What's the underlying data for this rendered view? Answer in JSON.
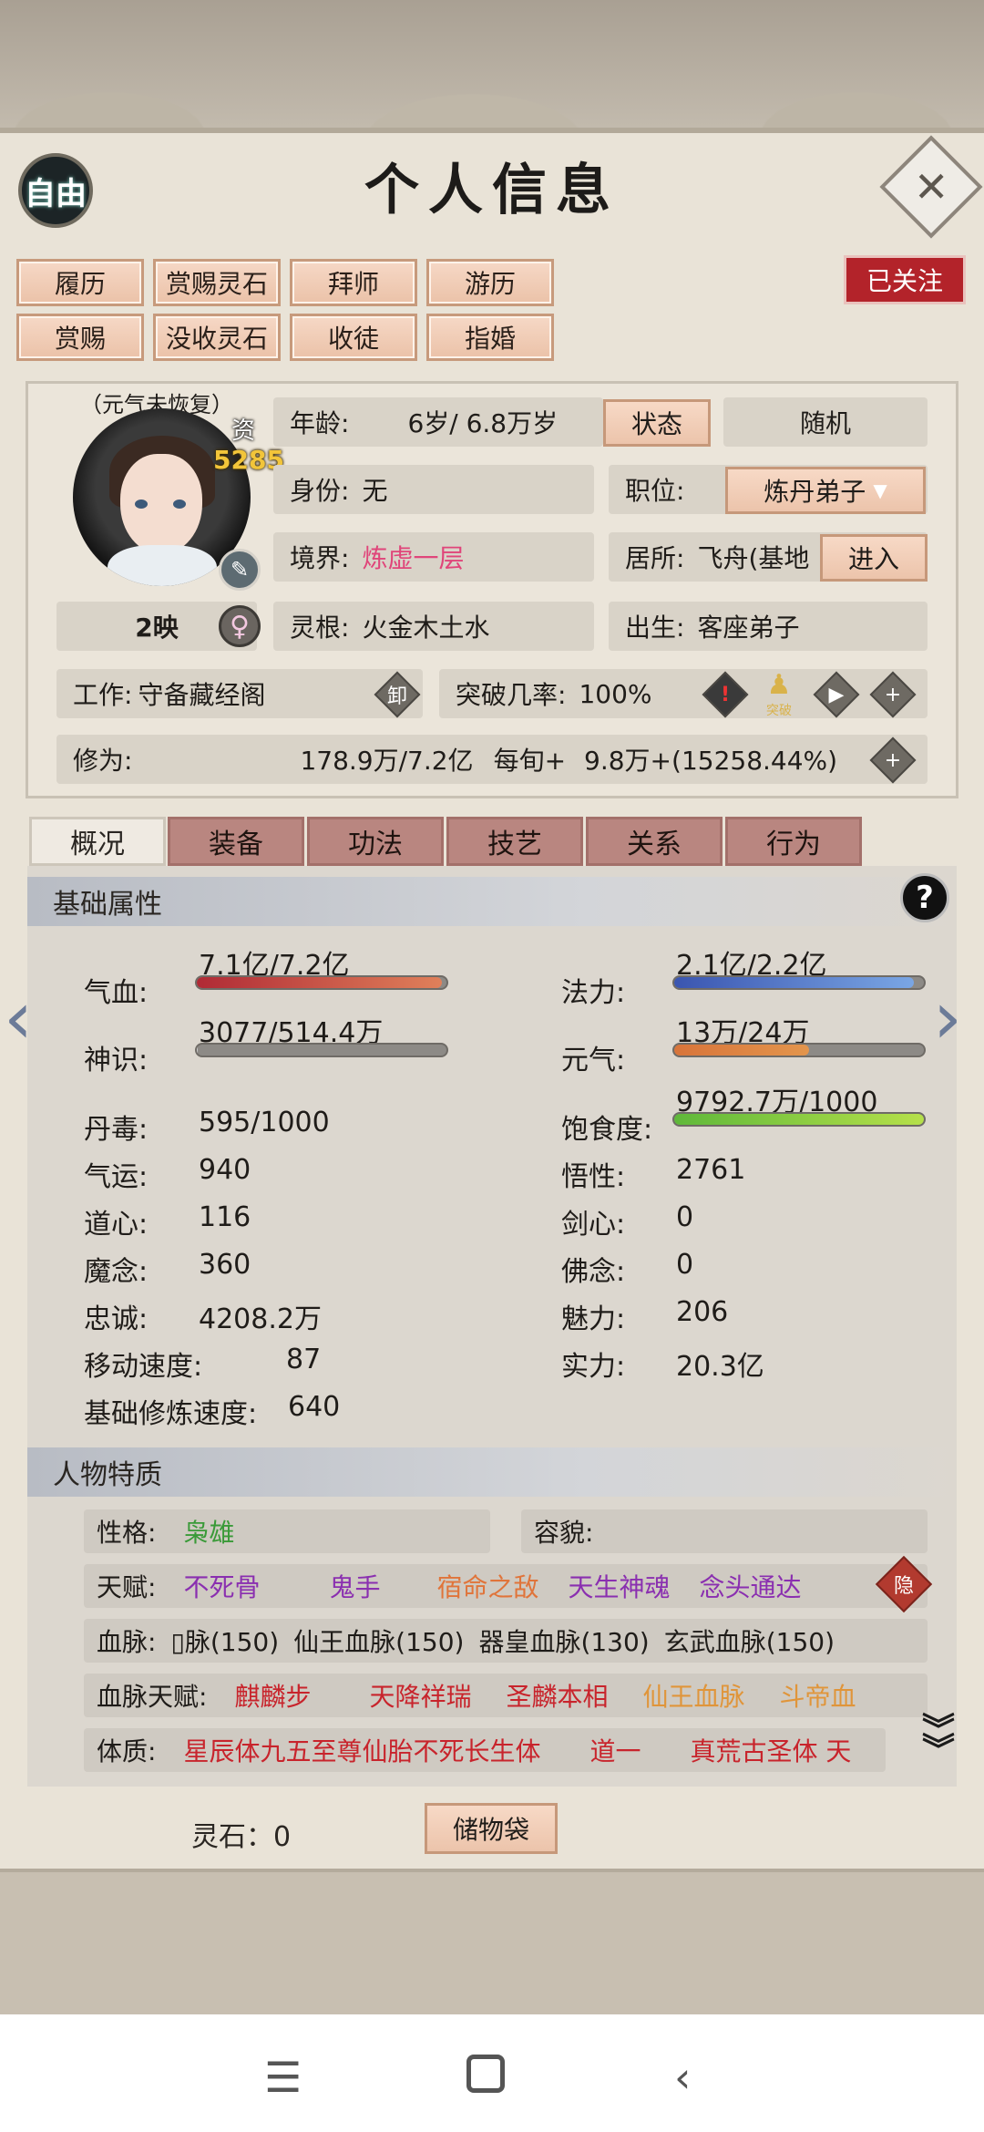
{
  "header": {
    "free_label": "自由",
    "title": "个人信息",
    "close_icon": "✕"
  },
  "actions": [
    "履历",
    "赏赐灵石",
    "拜师",
    "游历",
    "赏赐",
    "没收灵石",
    "收徒",
    "指婚"
  ],
  "followed_label": "已关注",
  "profile": {
    "status_note": "（元气未恢复）",
    "aptitude_label": "资",
    "aptitude_value": "5285",
    "reflection": "2映",
    "gender_icon": "♀",
    "age_label": "年龄:",
    "age_value": "6岁/ 6.8万岁",
    "status_btn": "状态",
    "random_btn": "随机",
    "identity_label": "身份:",
    "identity_value": "无",
    "post_label": "职位:",
    "post_value": "炼丹弟子",
    "realm_label": "境界:",
    "realm_value": "炼虚一层",
    "residence_label": "居所:",
    "residence_value": "飞舟(基地",
    "enter_btn": "进入",
    "root_label": "灵根:",
    "root_value": "火金木土水",
    "birth_label": "出生:",
    "birth_value": "客座弟子",
    "work_label": "工作:",
    "work_value": "守备藏经阁",
    "unload_icon": "卸",
    "breakthrough_label": "突破几率:",
    "breakthrough_value": "100%",
    "breakthrough_small": "突破",
    "cultivation_label": "修为:",
    "cultivation_value": "178.9万/7.2亿",
    "per_turn_label": "每旬+",
    "per_turn_value": "9.8万+(15258.44%)"
  },
  "tabs": [
    "概况",
    "装备",
    "功法",
    "技艺",
    "关系",
    "行为"
  ],
  "basic": {
    "title": "基础属性",
    "help_icon": "?",
    "hp_label": "气血:",
    "hp_value": "7.1亿/7.2亿",
    "hp_ratio": 0.98,
    "mana_label": "法力:",
    "mana_value": "2.1亿/2.2亿",
    "mana_ratio": 0.96,
    "sense_label": "神识:",
    "sense_value": "3077/514.4万",
    "sense_ratio": 0.0006,
    "vigor_label": "元气:",
    "vigor_value": "13万/24万",
    "vigor_ratio": 0.54,
    "pill_label": "丹毒:",
    "pill_value": "595/1000",
    "satiety_label": "饱食度:",
    "satiety_value": "9792.7万/1000",
    "satiety_ratio": 1.0,
    "luck_label": "气运:",
    "luck_value": "940",
    "wisdom_label": "悟性:",
    "wisdom_value": "2761",
    "dao_label": "道心:",
    "dao_value": "116",
    "sword_label": "剑心:",
    "sword_value": "0",
    "demon_label": "魔念:",
    "demon_value": "360",
    "buddha_label": "佛念:",
    "buddha_value": "0",
    "loyal_label": "忠诚:",
    "loyal_value": "4208.2万",
    "charm_label": "魅力:",
    "charm_value": "206",
    "speed_label": "移动速度:",
    "speed_value": "87",
    "power_label": "实力:",
    "power_value": "20.3亿",
    "train_label": "基础修炼速度:",
    "train_value": "640"
  },
  "traits": {
    "title": "人物特质",
    "personality_label": "性格:",
    "personality_value": "枭雄",
    "looks_label": "容貌:",
    "talent_label": "天赋:",
    "talents": [
      "不死骨",
      "鬼手",
      "宿命之敌",
      "天生神魂",
      "念头通达"
    ],
    "hide_icon": "隐",
    "blood_label": "血脉:",
    "bloods": [
      "▯脉(150)",
      "仙王血脉(150)",
      "器皇血脉(130)",
      "玄武血脉(150)"
    ],
    "blood_talent_label": "血脉天赋:",
    "blood_talents": [
      "麒麟步",
      "天降祥瑞",
      "圣麟本相",
      "仙王血脉",
      "斗帝血"
    ],
    "physique_label": "体质:",
    "physiques": [
      "星辰体九五至尊仙胎不死长生体",
      "道一",
      "真荒古圣体 天"
    ]
  },
  "footer": {
    "stones_label": "灵石：",
    "stones_value": "0",
    "storage_btn": "储物袋"
  },
  "colors": {
    "accent_red": "#b3232a",
    "realm_pink": "#e0457a",
    "purple": "#8a2fb0"
  }
}
